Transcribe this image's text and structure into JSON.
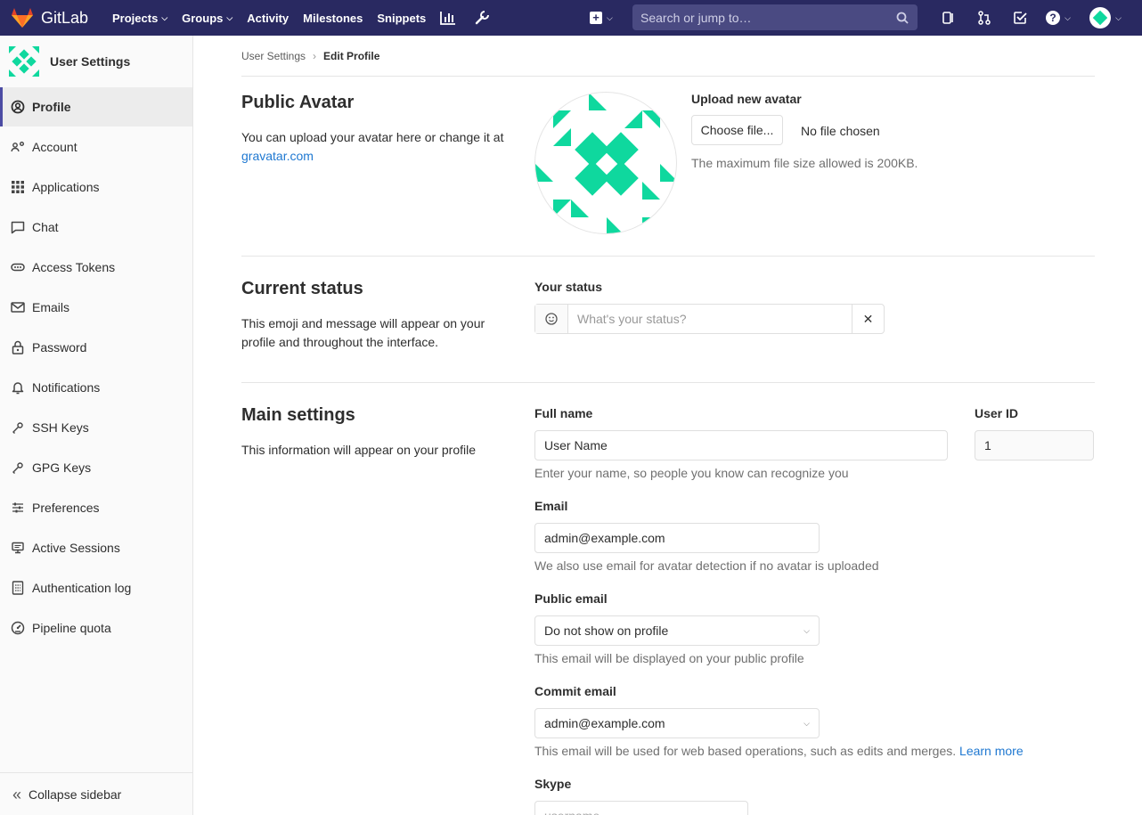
{
  "navbar": {
    "brand": "GitLab",
    "links": [
      {
        "label": "Projects",
        "dropdown": true
      },
      {
        "label": "Groups",
        "dropdown": true
      },
      {
        "label": "Activity",
        "dropdown": false
      },
      {
        "label": "Milestones",
        "dropdown": false
      },
      {
        "label": "Snippets",
        "dropdown": false
      }
    ],
    "search_placeholder": "Search or jump to…",
    "colors": {
      "bar": "#292961",
      "search": "#4a4a82",
      "accent": "#e24329"
    }
  },
  "sidebar": {
    "title": "User Settings",
    "items": [
      {
        "label": "Profile",
        "icon": "profile-icon",
        "active": true
      },
      {
        "label": "Account",
        "icon": "account-icon"
      },
      {
        "label": "Applications",
        "icon": "applications-icon"
      },
      {
        "label": "Chat",
        "icon": "chat-icon"
      },
      {
        "label": "Access Tokens",
        "icon": "access-tokens-icon"
      },
      {
        "label": "Emails",
        "icon": "emails-icon"
      },
      {
        "label": "Password",
        "icon": "lock-icon"
      },
      {
        "label": "Notifications",
        "icon": "bell-icon"
      },
      {
        "label": "SSH Keys",
        "icon": "key-icon"
      },
      {
        "label": "GPG Keys",
        "icon": "key-icon"
      },
      {
        "label": "Preferences",
        "icon": "preferences-icon"
      },
      {
        "label": "Active Sessions",
        "icon": "monitor-icon"
      },
      {
        "label": "Authentication log",
        "icon": "log-icon"
      },
      {
        "label": "Pipeline quota",
        "icon": "gauge-icon"
      }
    ],
    "collapse_label": "Collapse sidebar"
  },
  "breadcrumb": {
    "parent": "User Settings",
    "current": "Edit Profile"
  },
  "avatar_section": {
    "title": "Public Avatar",
    "desc": "You can upload your avatar here or change it at",
    "link": "gravatar.com",
    "upload_label": "Upload new avatar",
    "choose_button": "Choose file...",
    "no_file": "No file chosen",
    "help": "The maximum file size allowed is 200KB.",
    "avatar_color": "#0fd89e"
  },
  "status_section": {
    "title": "Current status",
    "desc": "This emoji and message will appear on your profile and throughout the interface.",
    "label": "Your status",
    "placeholder": "What's your status?"
  },
  "main_section": {
    "title": "Main settings",
    "desc": "This information will appear on your profile",
    "full_name_label": "Full name",
    "full_name_value": "User Name",
    "full_name_help": "Enter your name, so people you know can recognize you",
    "user_id_label": "User ID",
    "user_id_value": "1",
    "email_label": "Email",
    "email_value": "admin@example.com",
    "email_help": "We also use email for avatar detection if no avatar is uploaded",
    "public_email_label": "Public email",
    "public_email_value": "Do not show on profile",
    "public_email_help": "This email will be displayed on your public profile",
    "commit_email_label": "Commit email",
    "commit_email_value": "admin@example.com",
    "commit_email_help": "This email will be used for web based operations, such as edits and merges.",
    "learn_more": "Learn more",
    "skype_label": "Skype",
    "skype_placeholder": "username"
  }
}
